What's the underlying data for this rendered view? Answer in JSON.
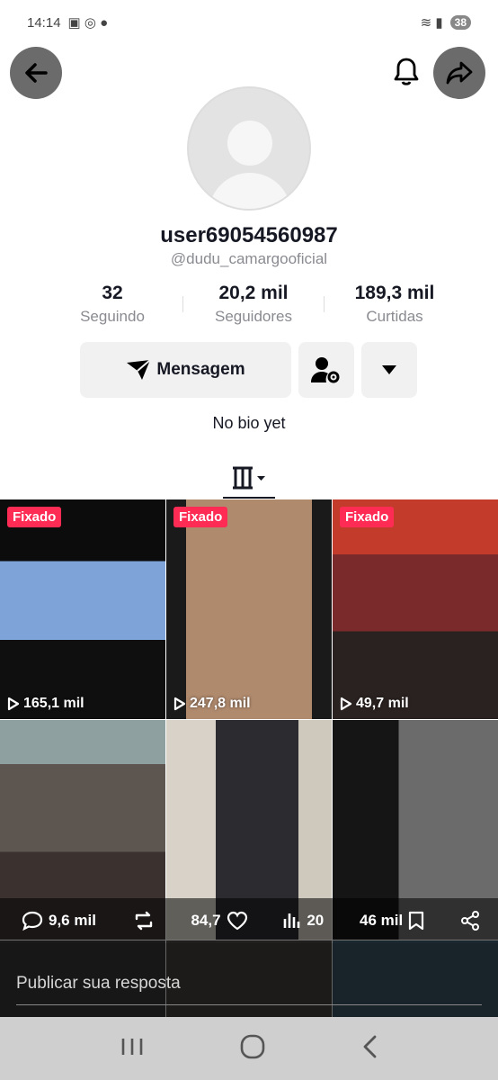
{
  "status_bar": {
    "time": "14:14",
    "battery": "38"
  },
  "profile": {
    "username": "user69054560987",
    "handle": "@dudu_camargooficial",
    "bio": "No bio yet"
  },
  "stats": [
    {
      "value": "32",
      "label": "Seguindo"
    },
    {
      "value": "20,2 mil",
      "label": "Seguidores"
    },
    {
      "value": "189,3 mil",
      "label": "Curtidas"
    }
  ],
  "actions": {
    "message_label": "Mensagem"
  },
  "videos": [
    {
      "pinned": "Fixado",
      "views": "165,1 mil"
    },
    {
      "pinned": "Fixado",
      "views": "247,8 mil"
    },
    {
      "pinned": "Fixado",
      "views": "49,7 mil"
    }
  ],
  "overlay": {
    "comments": "9,6 mil",
    "likes": "84,7",
    "stats": "20",
    "saves": "46 mil"
  },
  "reply": {
    "placeholder": "Publicar sua resposta"
  },
  "colors": {
    "accent": "#fe2c55",
    "text": "#161823",
    "muted": "#8a8b91"
  }
}
